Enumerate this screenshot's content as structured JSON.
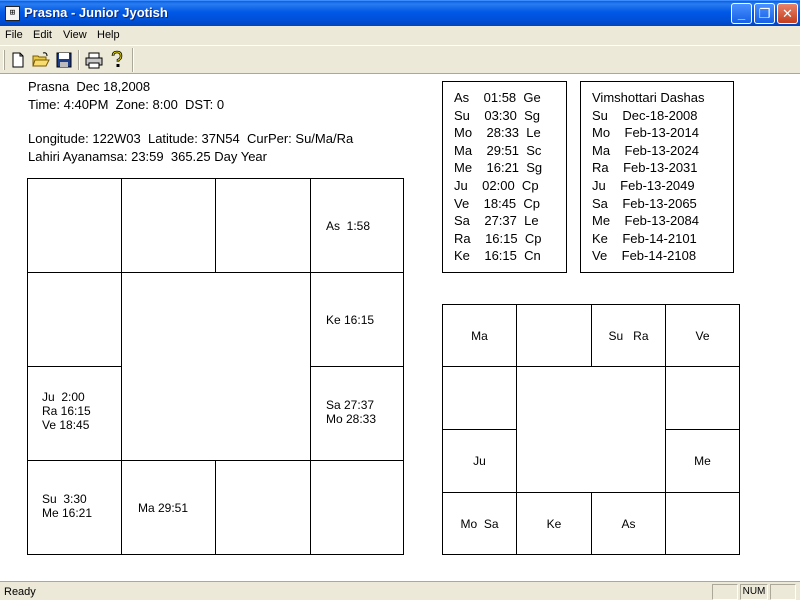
{
  "window": {
    "title": "Prasna - Junior Jyotish",
    "icon_name": "app-icon",
    "minimize_glyph": "_",
    "maximize_glyph": "❐",
    "close_glyph": "✕"
  },
  "menu": [
    "File",
    "Edit",
    "View",
    "Help"
  ],
  "toolbar": {
    "icons": [
      "new-file-icon",
      "open-folder-icon",
      "save-icon",
      "print-icon",
      "help-icon"
    ]
  },
  "info": {
    "line1": "Prasna  Dec 18,2008",
    "line2": "Time: 4:40PM  Zone: 8:00  DST: 0",
    "line3": "Longitude: 122W03  Latitude: 37N54  CurPer: Su/Ma/Ra",
    "line4": "Lahiri Ayanamsa: 23:59  365.25 Day Year"
  },
  "main_chart": {
    "r0c3": "As  1:58",
    "r1c3": "Ke 16:15",
    "r2c0": "Ju  2:00\nRa 16:15\nVe 18:45",
    "r2c3": "Sa 27:37\nMo 28:33",
    "r3c0": "Su  3:30\nMe 16:21",
    "r3c1": "Ma 29:51"
  },
  "positions": {
    "rows": [
      "As    01:58  Ge",
      "Su    03:30  Sg",
      "Mo    28:33  Le",
      "Ma    29:51  Sc",
      "Me    16:21  Sg",
      "Ju    02:00  Cp",
      "Ve    18:45  Cp",
      "Sa    27:37  Le",
      "Ra    16:15  Cp",
      "Ke    16:15  Cn"
    ]
  },
  "dashas": {
    "title": "Vimshottari Dashas",
    "rows": [
      "Su    Dec-18-2008",
      "Mo    Feb-13-2014",
      "Ma    Feb-13-2024",
      "Ra    Feb-13-2031",
      "Ju    Feb-13-2049",
      "Sa    Feb-13-2065",
      "Me    Feb-13-2084",
      "Ke    Feb-14-2101",
      "Ve    Feb-14-2108"
    ]
  },
  "navamsa_chart": {
    "r0c0": "Ma",
    "r0c2": "Su   Ra",
    "r0c3": "Ve",
    "r2c0": "Ju",
    "r2c3": "Me",
    "r3c0": "Mo  Sa",
    "r3c1": "Ke",
    "r3c2": "As"
  },
  "status": {
    "text": "Ready",
    "num": "NUM"
  }
}
